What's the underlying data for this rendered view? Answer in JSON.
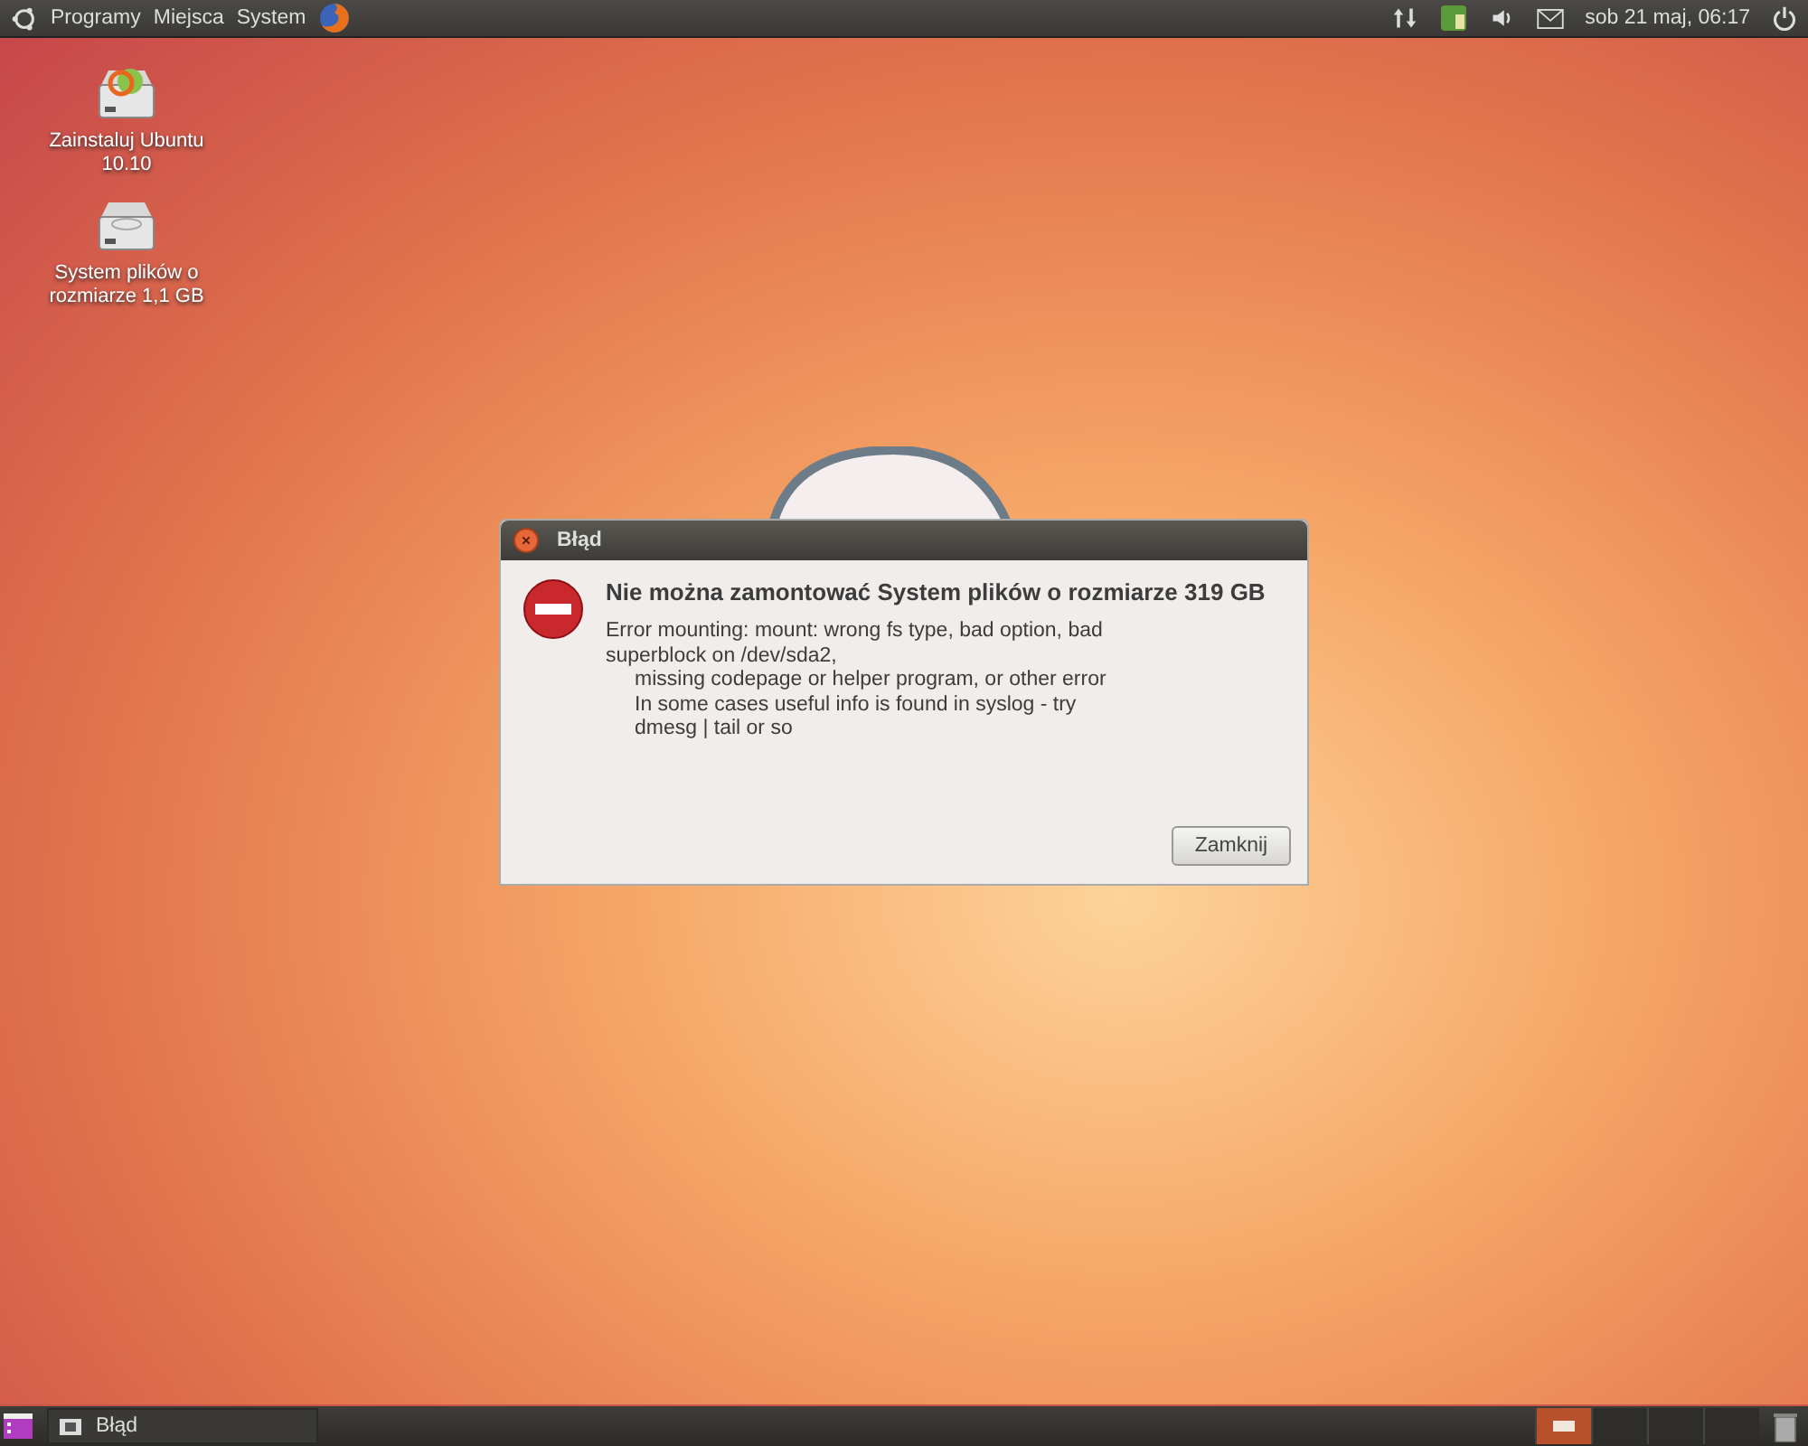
{
  "top_panel": {
    "menus": [
      "Programy",
      "Miejsca",
      "System"
    ],
    "clock": "sob 21 maj, 06:17"
  },
  "desktop_icons": [
    {
      "kind": "installer",
      "label": "Zainstaluj Ubuntu 10.10"
    },
    {
      "kind": "drive",
      "label": "System plików o rozmiarze 1,1 GB"
    }
  ],
  "dialog": {
    "title": "Błąd",
    "heading": "Nie można zamontować System plików o rozmiarze 319 GB",
    "lines": [
      {
        "text": "Error mounting: mount: wrong fs type, bad option, bad",
        "indented": false
      },
      {
        "text": "superblock on /dev/sda2,",
        "indented": false
      },
      {
        "text": "missing codepage or helper program, or other error",
        "indented": true
      },
      {
        "text": "In some cases useful info is found in syslog - try",
        "indented": true
      },
      {
        "text": "dmesg | tail  or so",
        "indented": true
      }
    ],
    "button": "Zamknij"
  },
  "bottom_panel": {
    "tasks": [
      {
        "label": "Błąd",
        "selected": false
      }
    ],
    "workspaces": [
      {
        "selected": true
      },
      {
        "selected": false
      },
      {
        "selected": false
      },
      {
        "selected": false
      }
    ]
  }
}
